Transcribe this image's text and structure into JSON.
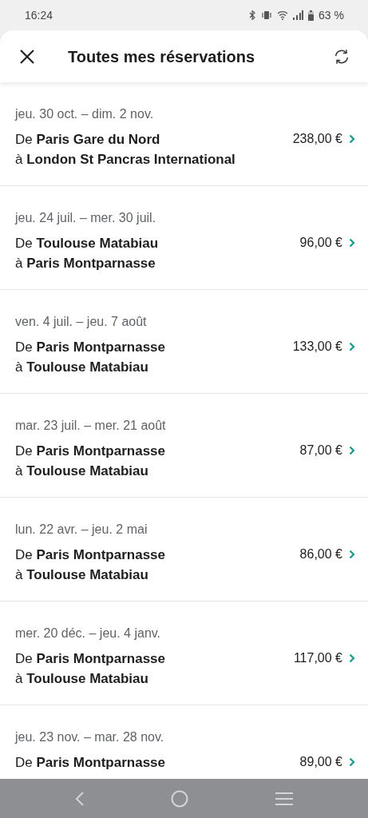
{
  "status_bar": {
    "time": "16:24",
    "battery": "63 %"
  },
  "header": {
    "title": "Toutes mes réservations"
  },
  "reservations": [
    {
      "dates": "jeu. 30 oct. – dim. 2 nov.",
      "from": "De **Paris Gare du Nord**",
      "to": "à **London St Pancras International**",
      "price": "238,00 €"
    },
    {
      "dates": "jeu. 24 juil. – mer. 30 juil.",
      "from": "De **Toulouse Matabiau**",
      "to": "à **Paris Montparnasse**",
      "price": "96,00 €"
    },
    {
      "dates": "ven. 4 juil. – jeu. 7 août",
      "from": "De **Paris Montparnasse**",
      "to": "à **Toulouse Matabiau**",
      "price": "133,00 €"
    },
    {
      "dates": "mar. 23 juil. – mer. 21 août",
      "from": "De **Paris Montparnasse**",
      "to": "à **Toulouse Matabiau**",
      "price": "87,00 €"
    },
    {
      "dates": "lun. 22 avr. – jeu. 2 mai",
      "from": "De **Paris Montparnasse**",
      "to": "à **Toulouse Matabiau**",
      "price": "86,00 €"
    },
    {
      "dates": "mer. 20 déc. – jeu. 4 janv.",
      "from": "De **Paris Montparnasse**",
      "to": "à **Toulouse Matabiau**",
      "price": "117,00 €"
    },
    {
      "dates": "jeu. 23 nov. – mar. 28 nov.",
      "from": "De **Paris Montparnasse**",
      "price": "89,00 €"
    }
  ]
}
